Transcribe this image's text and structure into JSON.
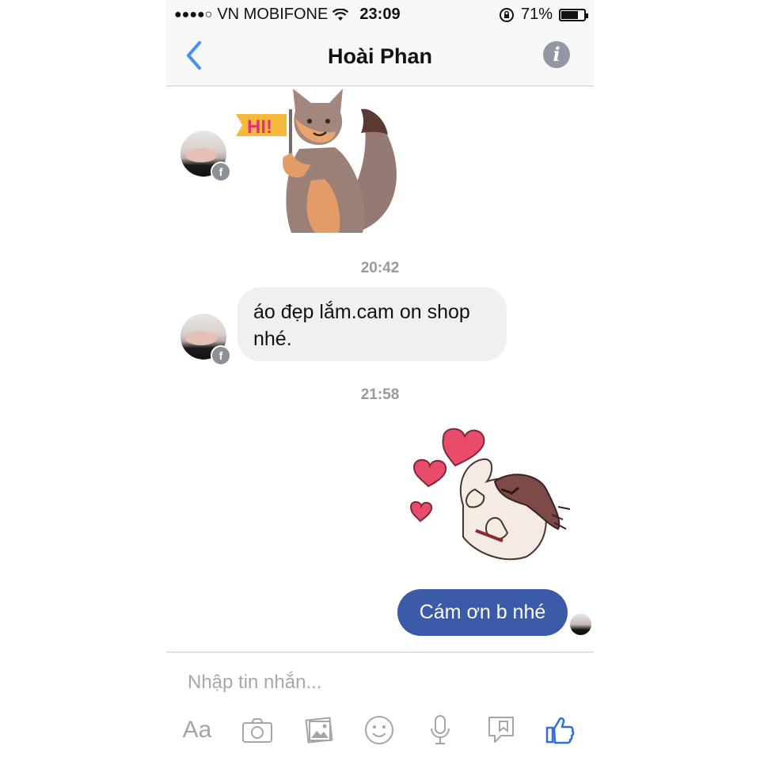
{
  "status_bar": {
    "signal_dots": "●●●●○",
    "carrier": "VN MOBIFONE",
    "time": "23:09",
    "battery_percent": "71%",
    "battery_level": 0.71
  },
  "header": {
    "title": "Hoài Phan"
  },
  "messages": {
    "time_1": "20:42",
    "incoming_text": "áo đẹp lắm.cam on shop nhé.",
    "time_2": "21:58",
    "outgoing_text": "Cám ơn b nhé",
    "sticker_1_text": "HI!"
  },
  "composer": {
    "placeholder": "Nhập tin nhắn...",
    "text_format_label": "Aa"
  },
  "colors": {
    "accent_blue": "#3b5ba8",
    "ios_blue": "#4a8ef0",
    "incoming_bubble": "#f0f0f0"
  },
  "icons": [
    "back-icon",
    "info-icon",
    "camera-icon",
    "gallery-icon",
    "emoji-icon",
    "microphone-icon",
    "sticker-icon",
    "like-icon"
  ]
}
